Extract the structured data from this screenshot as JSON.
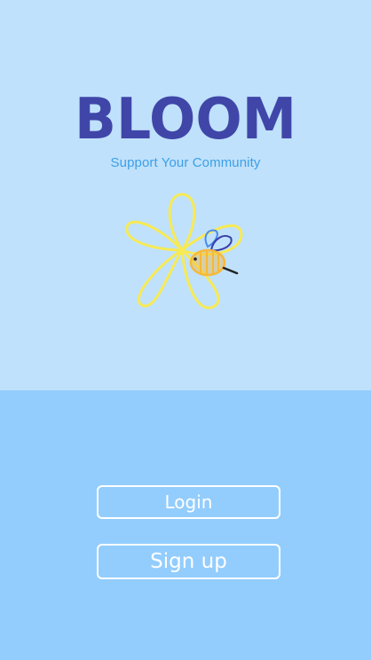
{
  "app": {
    "name": "BLOOM",
    "tagline": "Support Your Community"
  },
  "auth": {
    "login_label": "Login",
    "signup_label": "Sign up"
  },
  "colors": {
    "hero_background": "#bfe1fb",
    "actions_background": "#93cdfd",
    "brand": "#4046a8",
    "tagline": "#3d9fe6",
    "flower_outline": "#f7ea55",
    "bee_body": "#f5b93a",
    "button_border": "#ffffff"
  },
  "icons": {
    "emblem": "flower-with-bee-icon"
  }
}
